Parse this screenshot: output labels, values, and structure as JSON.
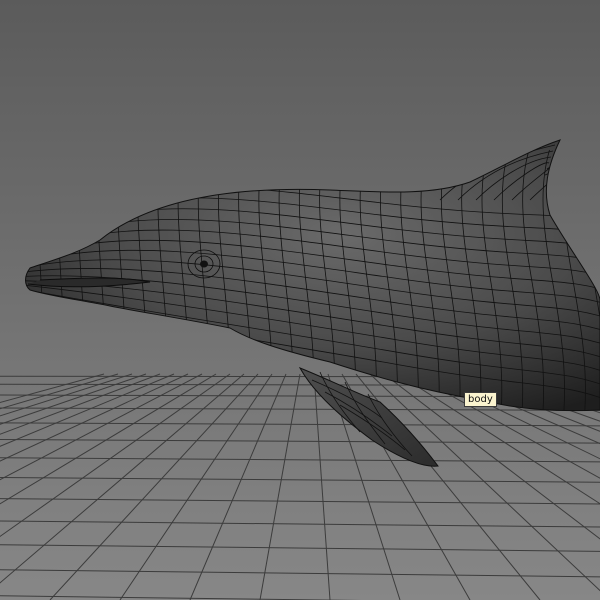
{
  "viewport": {
    "background_top": "#5d5d5d",
    "background_bottom": "#858585",
    "grid_color": "#3c3c3c",
    "wire_color": "#111111",
    "mesh_fill": "#5a5a5a"
  },
  "object": {
    "label": "body",
    "shape": "dolphin",
    "display": "wireframe-on-shaded"
  },
  "icons": [
    "dolphin-mesh-icon"
  ]
}
